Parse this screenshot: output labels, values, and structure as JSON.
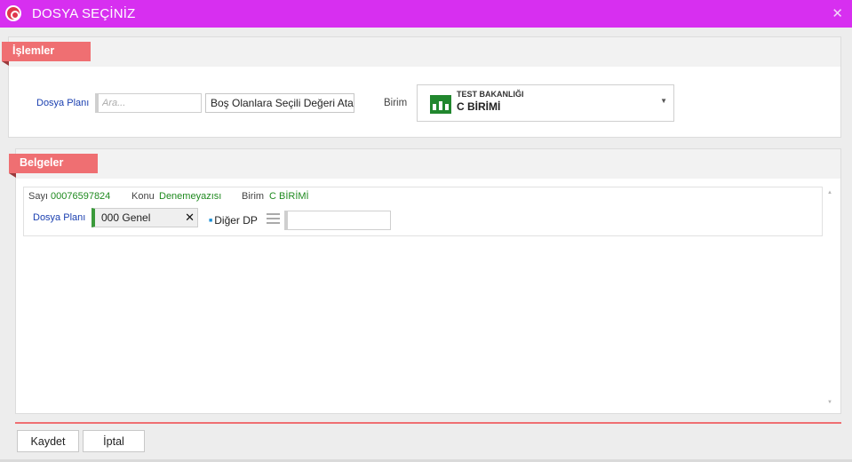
{
  "window": {
    "title": "DOSYA SEÇİNİZ"
  },
  "operations": {
    "header": "İşlemler",
    "file_plan_label": "Dosya Planı",
    "search_placeholder": "Ara...",
    "assign_button_label": "Boş Olanlara Seçili Değeri Ata",
    "unit_label": "Birim",
    "unit_select": {
      "organization": "TEST BAKANLIĞI",
      "unit": "C BİRİMİ"
    }
  },
  "documents": {
    "header": "Belgeler",
    "items": [
      {
        "number_label": "Sayı",
        "number": "00076597824",
        "subject_label": "Konu",
        "subject": "Denemeyazısı",
        "unit_label": "Birim",
        "unit": "C BİRİMİ",
        "file_plan_label": "Dosya Planı",
        "file_plan_value": "000 Genel",
        "other_dp_label": "Diğer DP",
        "other_dp_value": ""
      }
    ]
  },
  "footer": {
    "save_label": "Kaydet",
    "cancel_label": "İptal"
  },
  "colors": {
    "titlebar": "#d72ff0",
    "accent": "#ef6f72",
    "label_blue": "#1a3fb0",
    "value_green": "#1f8a1f",
    "unit_icon": "#21872e"
  }
}
